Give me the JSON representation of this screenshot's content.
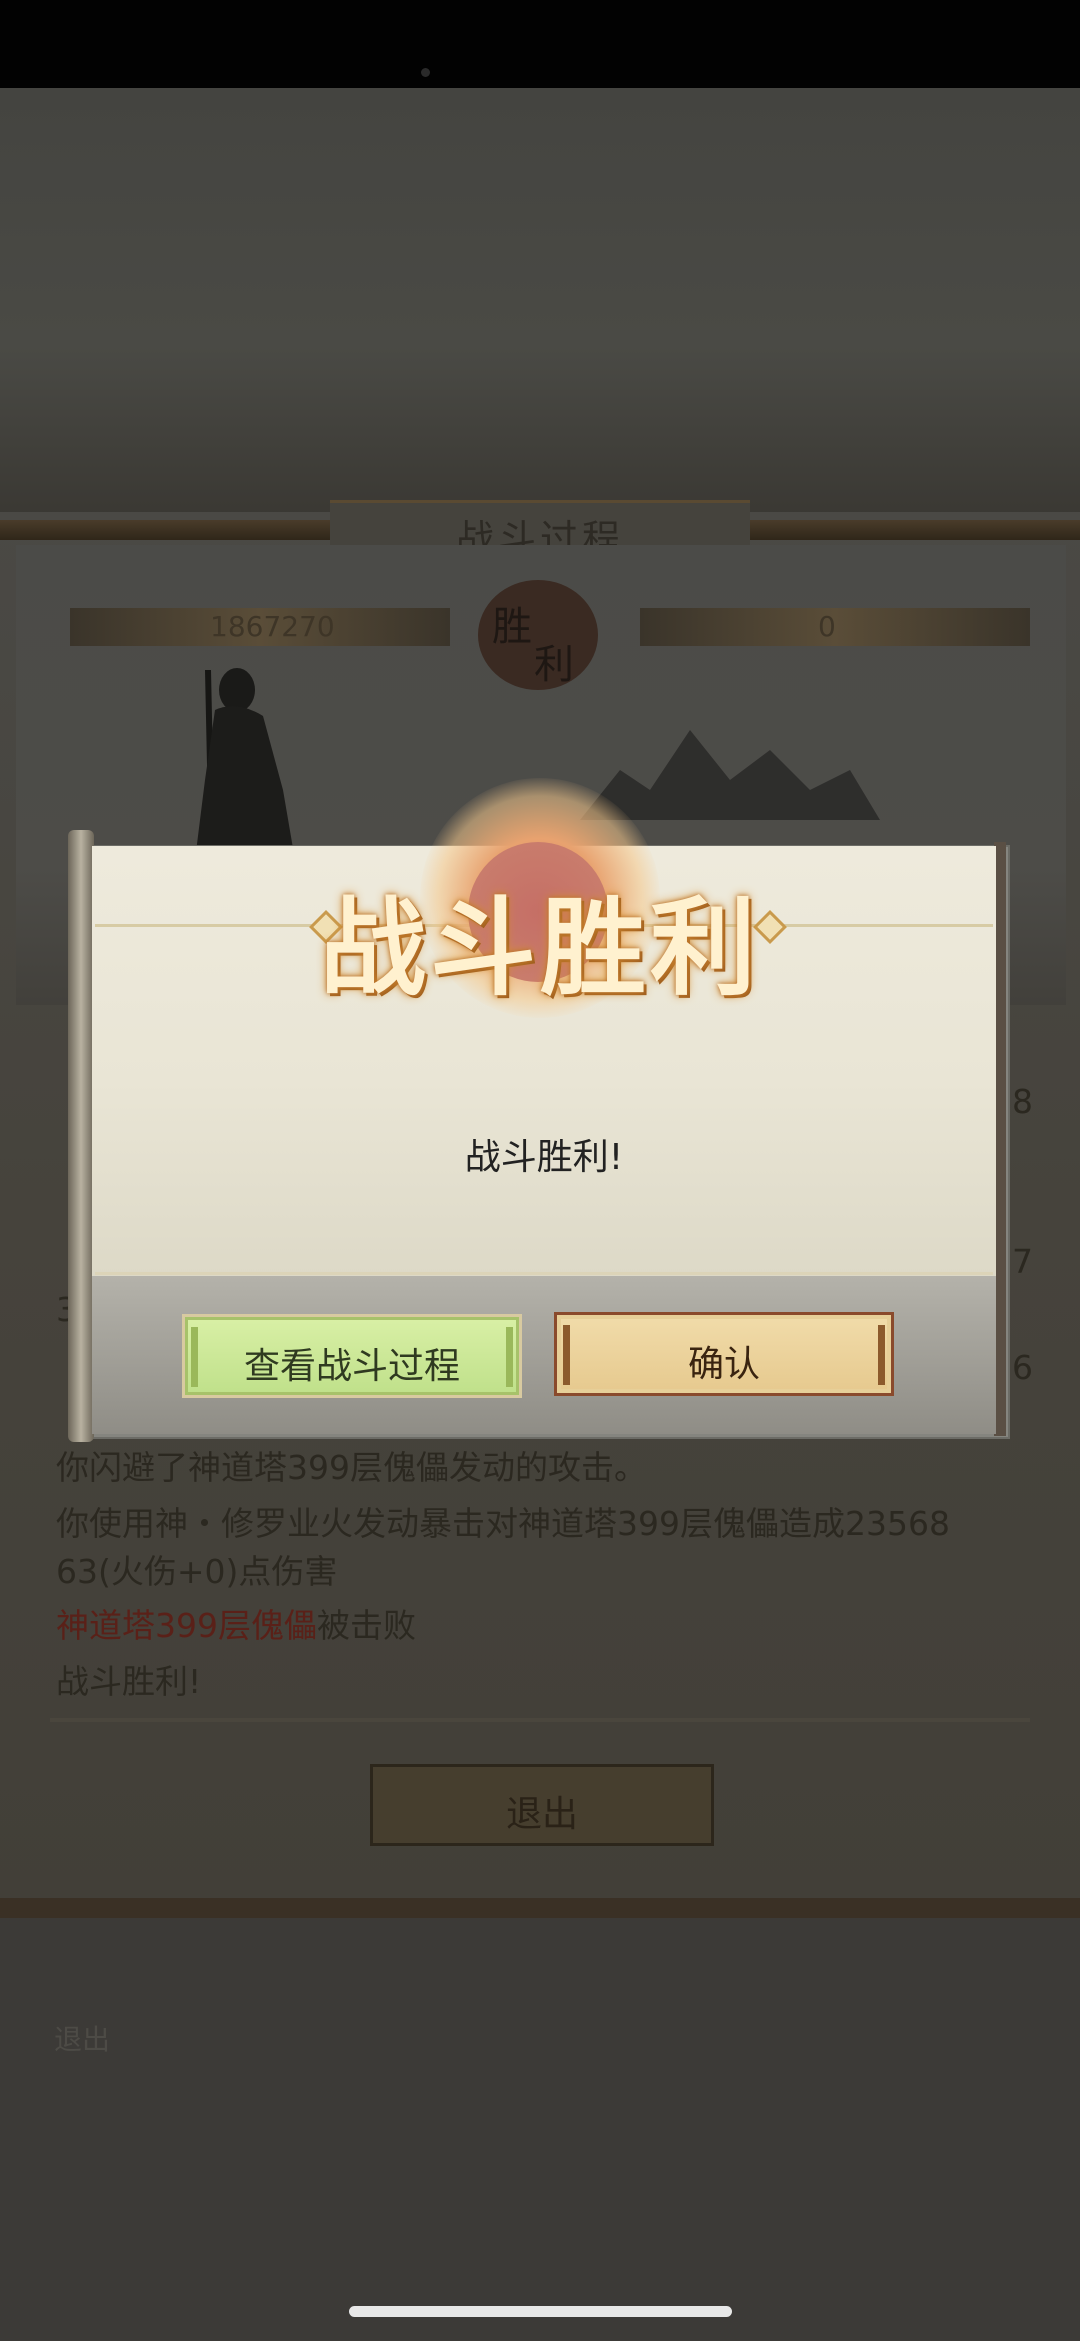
{
  "battle_panel": {
    "title": "战斗过程",
    "left_hp": "1867270",
    "right_hp": "0",
    "result_seal": [
      "胜",
      "利"
    ],
    "log_lines": [
      {
        "text": "你闪避了神道塔399层傀儡发动的攻击。",
        "color": "normal"
      },
      {
        "text": "你使用神・修罗业火发动暴击对神道塔399层傀儡造成23568",
        "color": "normal"
      },
      {
        "text": "63(火伤+0)点伤害",
        "color": "normal"
      },
      {
        "text": "神道塔399层傀儡",
        "suffix": "被击败",
        "color": "red"
      },
      {
        "text": "战斗胜利!",
        "color": "normal"
      }
    ],
    "partial_right": [
      "8",
      "7",
      "6"
    ],
    "partial_left": [
      "3"
    ],
    "exit_label": "退出"
  },
  "background_exit_label": "退出",
  "dialog": {
    "title": "战斗胜利",
    "message": "战斗胜利!",
    "view_button_label": "查看战斗过程",
    "confirm_button_label": "确认"
  },
  "colors": {
    "title_glow": "#d8902f",
    "view_button": "#cfe89a",
    "confirm_button": "#ebd29c"
  }
}
